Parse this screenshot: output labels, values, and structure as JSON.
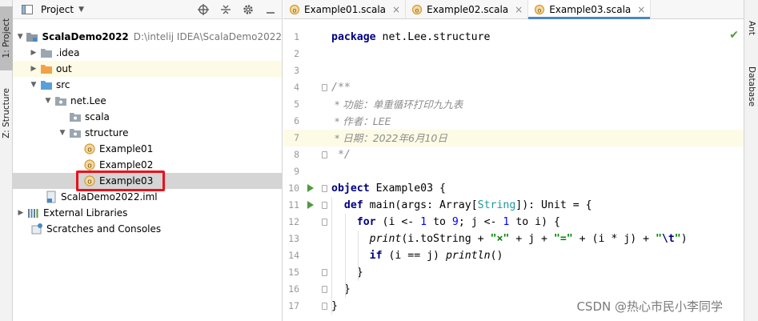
{
  "left_strip": {
    "project_tab": "1: Project",
    "structure_tab": "Z: Structure"
  },
  "right_strip": {
    "ant_tab": "Ant",
    "database_tab": "Database"
  },
  "project_panel": {
    "title": "Project",
    "tree": [
      {
        "label": "ScalaDemo2022",
        "path": "D:\\intelij IDEA\\ScalaDemo2022"
      },
      {
        "label": ".idea"
      },
      {
        "label": "out"
      },
      {
        "label": "src"
      },
      {
        "label": "net.Lee"
      },
      {
        "label": "scala"
      },
      {
        "label": "structure"
      },
      {
        "label": "Example01"
      },
      {
        "label": "Example02"
      },
      {
        "label": "Example03"
      },
      {
        "label": "ScalaDemo2022.iml"
      },
      {
        "label": "External Libraries"
      },
      {
        "label": "Scratches and Consoles"
      }
    ]
  },
  "editor": {
    "tabs": [
      {
        "label": "Example01.scala",
        "close": "×"
      },
      {
        "label": "Example02.scala",
        "close": "×"
      },
      {
        "label": "Example03.scala",
        "close": "×"
      }
    ],
    "line_numbers": [
      "1",
      "2",
      "3",
      "4",
      "5",
      "6",
      "7",
      "8",
      "9",
      "10",
      "11",
      "12",
      "13",
      "14",
      "15",
      "16",
      "17"
    ],
    "code": {
      "l1_kw": "package",
      "l1_rest": " net.Lee.structure",
      "l4": "/**",
      "l5": " * 功能：单重循环打印九九表",
      "l6": " * 作者：LEE",
      "l7": " * 日期：2022年6月10日",
      "l8": " */",
      "l10_kw": "object",
      "l10_rest": " Example03 {",
      "l11_kw": "def",
      "l11_a": " main(args: Array[",
      "l11_type": "String",
      "l11_b": "]): Unit = {",
      "l12_kw": "for",
      "l12_a": " (i <- ",
      "l12_n1": "1",
      "l12_b": " to ",
      "l12_n2": "9",
      "l12_c": "; j <- ",
      "l12_n3": "1",
      "l12_d": " to i) {",
      "l13_fn": "print",
      "l13_a": "(i.toString + ",
      "l13_s1": "\"×\"",
      "l13_b": " + j + ",
      "l13_s2": "\"=\"",
      "l13_c": " + (i * j) + ",
      "l13_s3a": "\"",
      "l13_esc": "\\t",
      "l13_s3b": "\"",
      "l13_d": ")",
      "l14_kw": "if",
      "l14_a": " (i == j) ",
      "l14_fn": "println",
      "l14_b": "()",
      "l15": "}",
      "l16": "}",
      "l17": "}"
    }
  },
  "watermark": "CSDN @热心市民小李同学",
  "colors": {
    "accent": "#4a88c7",
    "run": "#4f9b3c",
    "highlight_border": "#e8121c"
  }
}
